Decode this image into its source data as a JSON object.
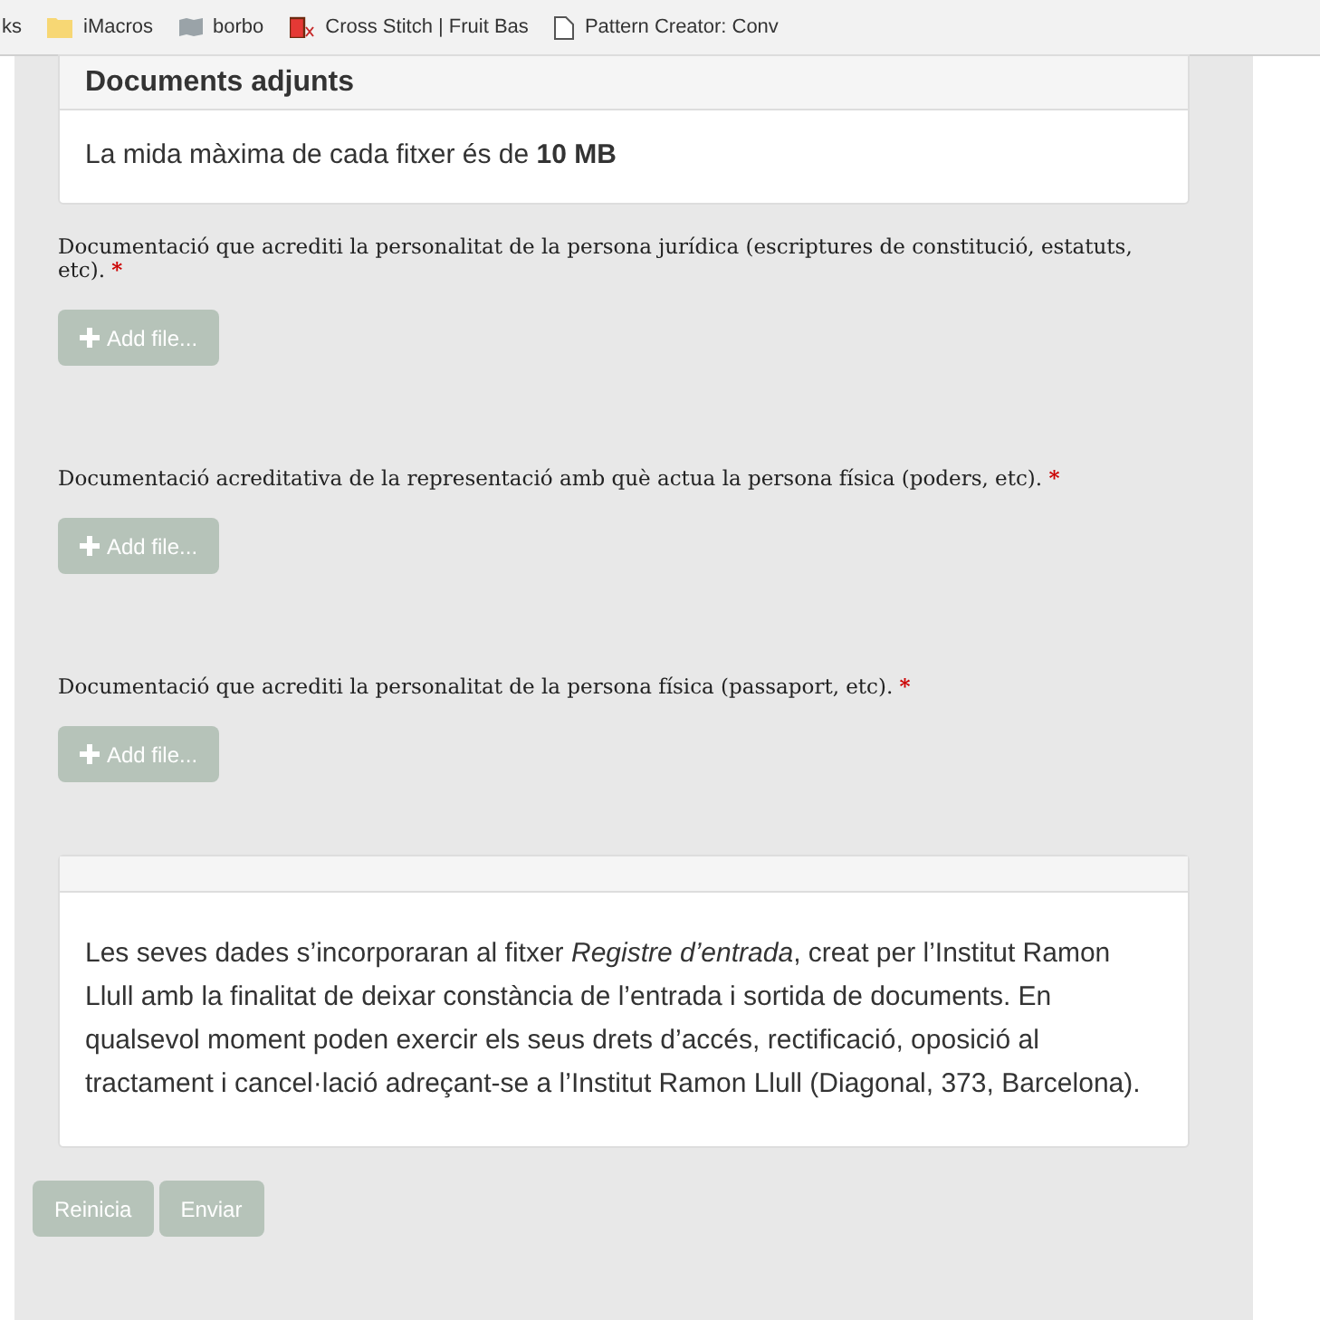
{
  "bookmarks_bar": [
    {
      "kind": "text",
      "label": "ks"
    },
    {
      "kind": "folder",
      "label": "iMacros"
    },
    {
      "kind": "map",
      "label": "borbo"
    },
    {
      "kind": "stitch",
      "label": "Cross Stitch | Fruit Bas"
    },
    {
      "kind": "page",
      "label": "Pattern Creator: Conv"
    }
  ],
  "attachments_card": {
    "title": "Documents adjunts",
    "note": "La mida màxima de cada fitxer és de **10 MB**"
  },
  "file_fields": [
    {
      "label": "Documentació que acrediti la personalitat de la persona jurídica (escriptures de constitució, estatuts, etc).",
      "required_mark": "*",
      "button": "Add file...",
      "disabled": true
    },
    {
      "label": "Documentació acreditativa de la representació amb què actua la persona física (poders, etc).",
      "required_mark": "*",
      "button": "Add file...",
      "disabled": true
    },
    {
      "label": "Documentació que acrediti la personalitat de la persona física (passaport, etc).",
      "required_mark": "*",
      "button": "Add file...",
      "disabled": true
    }
  ],
  "privacy_card": {
    "text": "Les seves dades s’incorporaran al fitxer *Registre d’entrada*, creat per l’Institut Ramon Llull amb la finalitat de deixar constància de l’entrada i sortida de documents. En qualsevol moment poden exercir els seus drets d’accés, rectificació, oposició al tractament i cancel·lació adreçant-se a l’Institut Ramon Llull (Diagonal, 373, Barcelona)."
  },
  "actions": [
    {
      "label": "Reinicia",
      "disabled": true
    },
    {
      "label": "Enviar",
      "disabled": true
    }
  ]
}
